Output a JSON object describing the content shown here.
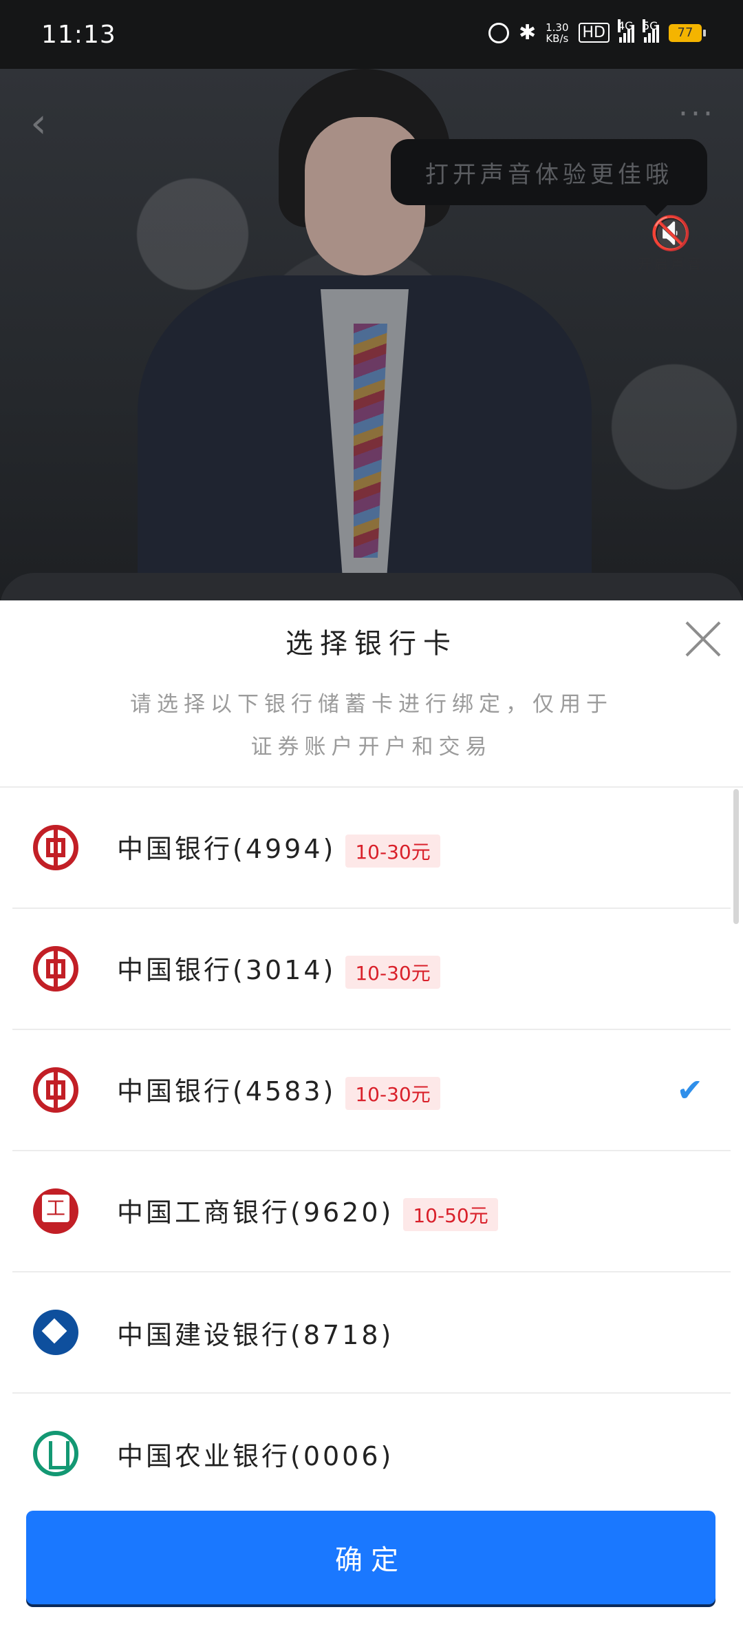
{
  "status_bar": {
    "time": "11:13",
    "net_speed_value": "1.30",
    "net_speed_unit": "KB/s",
    "hd": "HD",
    "sig1": "4G",
    "sig2": "5G",
    "battery": "77"
  },
  "video": {
    "tooltip": "打开声音体验更佳哦",
    "sound_label": "开启声音"
  },
  "sheet": {
    "title": "选择银行卡",
    "subtitle_line1": "请选择以下银行储蓄卡进行绑定，仅用于",
    "subtitle_line2": "证券账户开户和交易",
    "confirm_label": "确定"
  },
  "banks": [
    {
      "name": "中国银行(4994)",
      "badge": "10-30元",
      "selected": false,
      "logo": "boc-logo-icon"
    },
    {
      "name": "中国银行(3014)",
      "badge": "10-30元",
      "selected": false,
      "logo": "boc-logo-icon"
    },
    {
      "name": "中国银行(4583)",
      "badge": "10-30元",
      "selected": true,
      "logo": "boc-logo-icon"
    },
    {
      "name": "中国工商银行(9620)",
      "badge": "10-50元",
      "selected": false,
      "logo": "icbc-logo-icon"
    },
    {
      "name": "中国建设银行(8718)",
      "badge": "",
      "selected": false,
      "logo": "ccb-logo-icon"
    },
    {
      "name": "中国农业银行(0006)",
      "badge": "",
      "selected": false,
      "logo": "abc-logo-icon"
    }
  ],
  "colors": {
    "accent": "#1a78ff",
    "check": "#2f8fea",
    "badge_text": "#d9202a",
    "badge_bg": "#fde8e8"
  }
}
